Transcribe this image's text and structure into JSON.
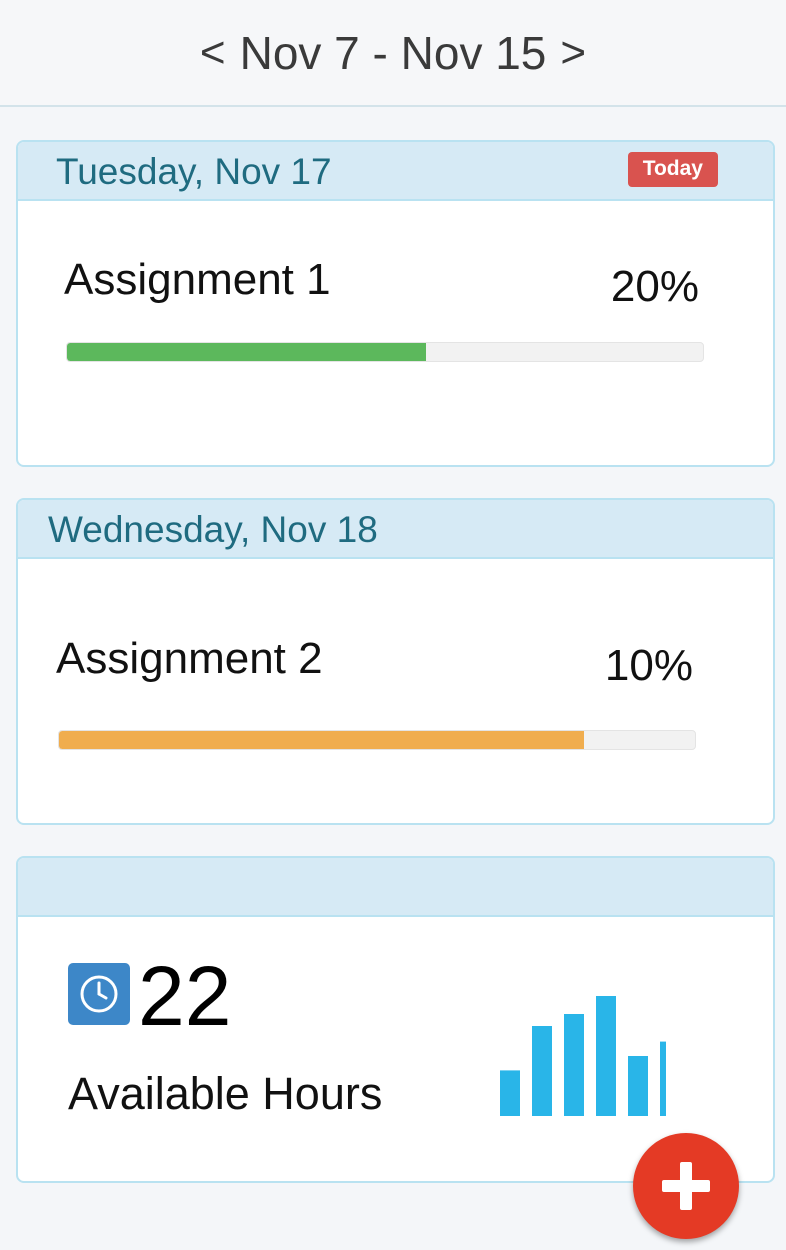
{
  "header": {
    "prev_arrow": "<",
    "week_range": "Nov 7 - Nov 15",
    "next_arrow": ">"
  },
  "days": [
    {
      "title": "Tuesday, Nov 17",
      "badge": "Today",
      "task": {
        "name": "Assignment 1",
        "percent_label": "20%",
        "progress_fill": 0.565,
        "color": "#5cb85c"
      }
    },
    {
      "title": "Wednesday, Nov 18",
      "task": {
        "name": "Assignment 2",
        "percent_label": "10%",
        "progress_fill": 0.825,
        "color": "#f0ad4e"
      }
    }
  ],
  "summary": {
    "title": "",
    "hours_value": "22",
    "hours_label": "Available Hours",
    "icon": "clock-icon",
    "bar_chart_icon": "bar-chart-icon",
    "chart_levels": [
      0.38,
      0.75,
      0.85,
      1.0,
      0.5,
      0.62
    ],
    "chart_color": "#29b5e8"
  },
  "fab": {
    "icon": "plus-icon",
    "color": "#e43a25"
  }
}
